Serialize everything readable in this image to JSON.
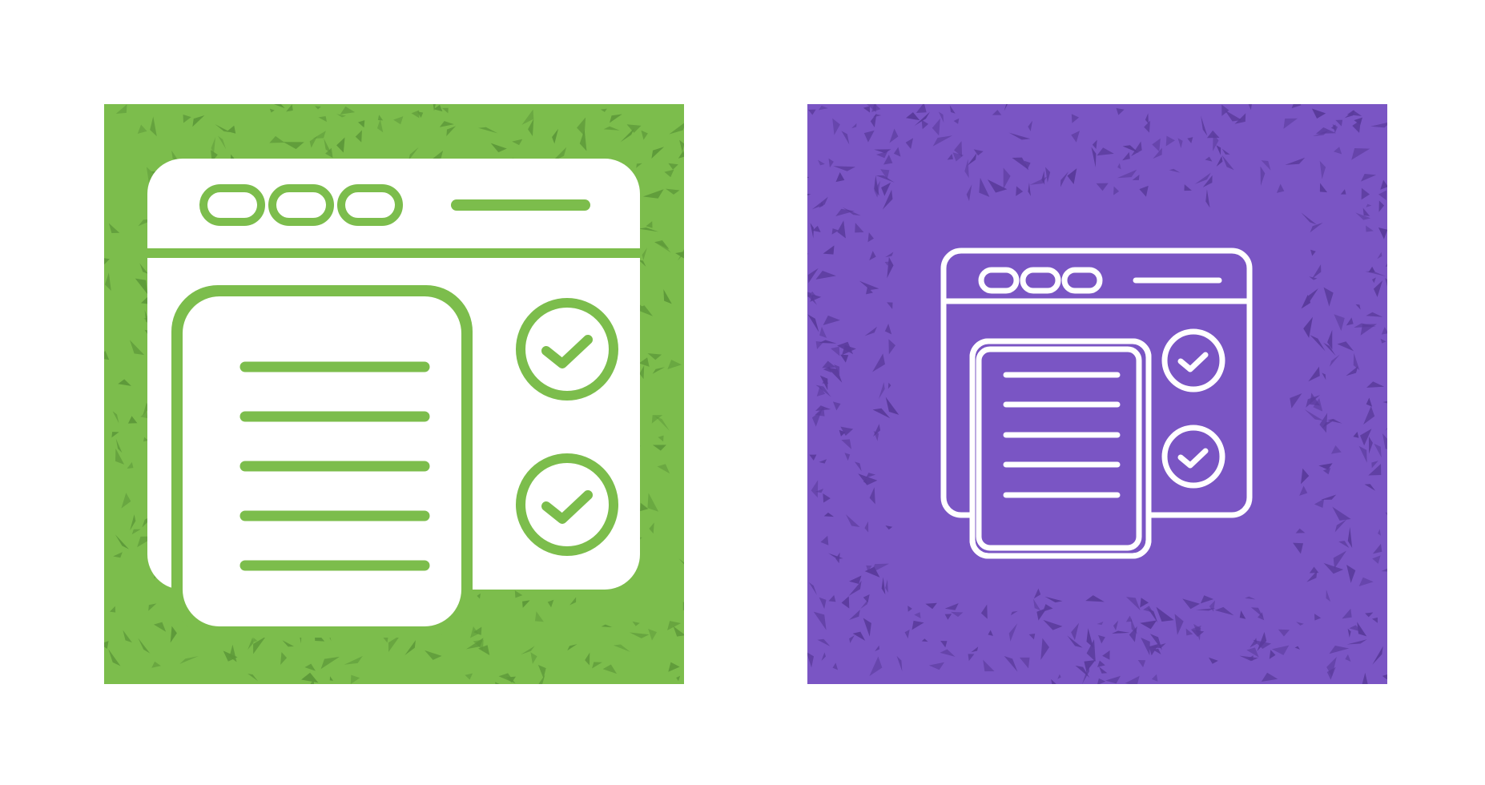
{
  "colors": {
    "page_background": "#ffffff",
    "green_tile": "#7cbd4c",
    "green_speckle": "#5e9a3a",
    "purple_tile": "#7a55c4",
    "purple_speckle": "#5a3b9c",
    "icon_foreground": "#ffffff"
  },
  "icons": [
    {
      "name": "browser-checklist-icon",
      "style": "glyph (filled)",
      "background": "green"
    },
    {
      "name": "browser-checklist-icon",
      "style": "outline",
      "background": "purple"
    }
  ]
}
